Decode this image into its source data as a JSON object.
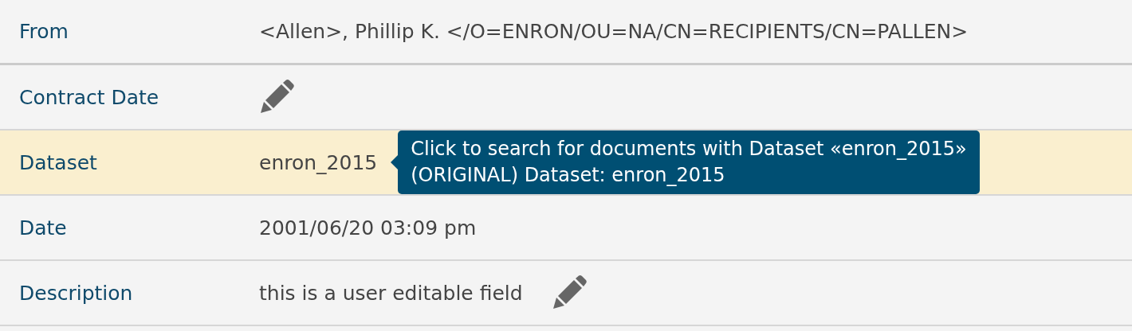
{
  "fields": [
    {
      "label": "From",
      "value": "<Allen>, Phillip K. </O=ENRON/OU=NA/CN=RECIPIENTS/CN=PALLEN>",
      "editable": false,
      "highlighted": false
    },
    {
      "label": "Contract Date",
      "editable": true,
      "highlighted": false
    },
    {
      "label": "Dataset",
      "value": "enron_2015",
      "editable": false,
      "highlighted": true,
      "tooltip": [
        "Click to search for documents with Dataset «enron_2015»",
        "(ORIGINAL) Dataset: enron_2015"
      ]
    },
    {
      "label": "Date",
      "value": "2001/06/20 03:09 pm",
      "editable": false,
      "highlighted": false
    },
    {
      "label": "Description",
      "value": "this is a user editable field",
      "editable": true,
      "highlighted": false
    }
  ]
}
